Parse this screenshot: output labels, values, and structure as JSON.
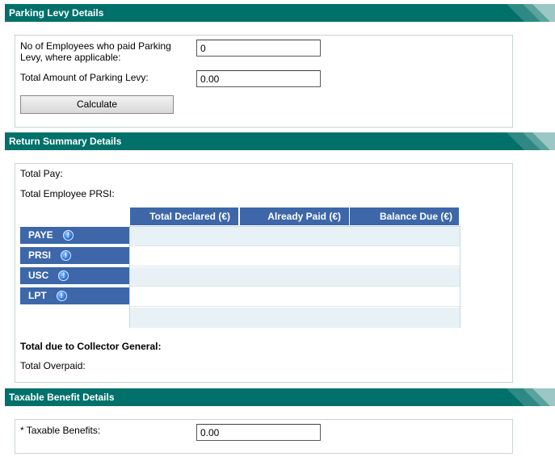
{
  "sections": {
    "parking": "Parking Levy Details",
    "summary": "Return Summary Details",
    "taxable": "Taxable Benefit Details"
  },
  "parking": {
    "employees_label": "No of Employees who paid Parking Levy, where applicable:",
    "employees_value": "0",
    "amount_label": "Total Amount of Parking Levy:",
    "amount_value": "0.00",
    "calculate_label": "Calculate"
  },
  "summary": {
    "total_pay_label": "Total Pay:",
    "total_prsi_label": "Total Employee PRSI:",
    "columns": [
      "Total Declared (€)",
      "Already Paid (€)",
      "Balance Due (€)"
    ],
    "rows": [
      "PAYE",
      "PRSI",
      "USC",
      "LPT"
    ],
    "info_glyph": "!",
    "total_due_label": "Total due to Collector General:",
    "total_overpaid_label": "Total Overpaid:"
  },
  "taxable": {
    "benefits_label": "* Taxable Benefits:",
    "benefits_value": "0.00"
  },
  "colors": {
    "section_header": "#00706a",
    "table_header": "#3d67a8",
    "row_alt": "#e8f1f6"
  },
  "icons": [
    "info-icon"
  ]
}
